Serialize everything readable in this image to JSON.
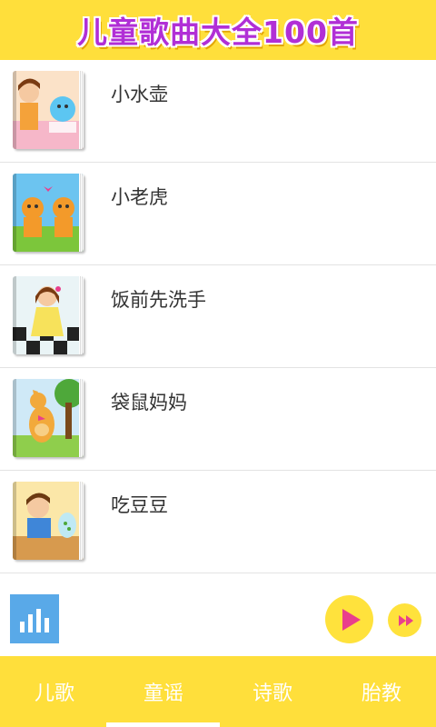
{
  "header": {
    "title": "儿童歌曲大全100首"
  },
  "songs": [
    {
      "title": "小水壶",
      "cover_icon": "kettle-cover-icon"
    },
    {
      "title": "小老虎",
      "cover_icon": "tiger-cover-icon"
    },
    {
      "title": "饭前先洗手",
      "cover_icon": "wash-hands-cover-icon"
    },
    {
      "title": "袋鼠妈妈",
      "cover_icon": "kangaroo-cover-icon"
    },
    {
      "title": "吃豆豆",
      "cover_icon": "eat-beans-cover-icon"
    }
  ],
  "player": {
    "equalizer_icon": "equalizer-icon",
    "play_icon": "play-icon",
    "fast_forward_icon": "fast-forward-icon"
  },
  "tabs": [
    {
      "label": "儿歌"
    },
    {
      "label": "童谣"
    },
    {
      "label": "诗歌"
    },
    {
      "label": "胎教"
    }
  ],
  "active_tab": "童谣",
  "colors": {
    "primary_yellow": "#ffdf3b",
    "title_purple": "#b12fd6",
    "accent_pink": "#e93f8c",
    "equalizer_blue": "#59a9e8"
  }
}
